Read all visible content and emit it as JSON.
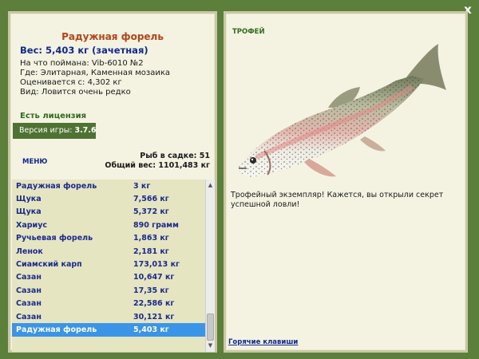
{
  "window": {
    "close_label": "x"
  },
  "fish": {
    "title": "Радужная форель",
    "weight_line": "Вес: 5,403 кг (зачетная)",
    "caught_on": "На что поймана: Vib-6010 №2",
    "location": "Где: Элитарная, Каменная мозаика",
    "valued_from": "Оценивается с: 4,302 кг",
    "kind": "Вид: Ловится очень редко"
  },
  "license": "Есть лицензия",
  "version": {
    "label": "Версия игры:",
    "value": "3.7.6"
  },
  "menu_label": "МЕНЮ",
  "stats": {
    "fish_in_cage": "Рыб в садке: 51",
    "total_weight": "Общий вес: 1101,483 кг"
  },
  "catch_list": [
    {
      "name": "Радужная форель",
      "weight": "3 кг"
    },
    {
      "name": "Щука",
      "weight": "7,566 кг"
    },
    {
      "name": "Щука",
      "weight": "5,372 кг"
    },
    {
      "name": "Хариус",
      "weight": "890 грамм"
    },
    {
      "name": "Ручьевая форель",
      "weight": "1,863 кг"
    },
    {
      "name": "Ленок",
      "weight": "2,181 кг"
    },
    {
      "name": "Сиамский карп",
      "weight": "173,013 кг"
    },
    {
      "name": "Сазан",
      "weight": "10,647 кг"
    },
    {
      "name": "Сазан",
      "weight": "17,35 кг"
    },
    {
      "name": "Сазан",
      "weight": "22,586 кг"
    },
    {
      "name": "Сазан",
      "weight": "30,121 кг"
    },
    {
      "name": "Радужная форель",
      "weight": "5,403 кг",
      "selected": true
    }
  ],
  "trophy": {
    "label": "ТРОФЕЙ",
    "text": "Трофейный экземпляр! Кажется, вы открыли секрет успешной ловли!"
  },
  "hotkeys_label": "Горячие клавиши",
  "colors": {
    "background": "#5d7f3c",
    "panel": "#f4f3e1",
    "list_bg": "#e6e5c2",
    "selection": "#3a95e8",
    "title": "#b4451a",
    "link": "#102890"
  },
  "icons": {
    "close": "close-icon",
    "scroll_up": "scroll-up-icon",
    "scroll_down": "scroll-down-icon"
  }
}
